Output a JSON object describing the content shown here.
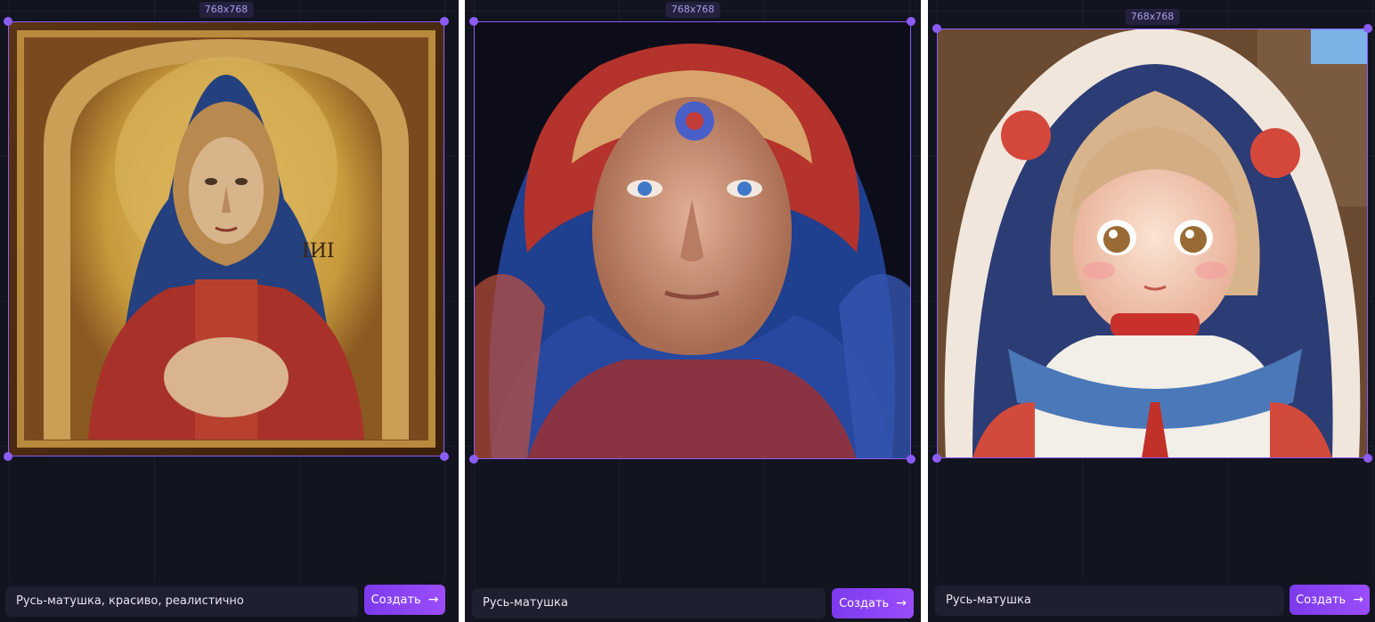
{
  "panels": [
    {
      "size_label": "768x768",
      "prompt": "Русь-матушка, красиво, реалистично",
      "button_label": "Создать",
      "button_icon": "arrow-right-icon",
      "image_subject": "icon-style portrait"
    },
    {
      "size_label": "768x768",
      "prompt": "Русь-матушка",
      "button_label": "Создать",
      "button_icon": "arrow-right-icon",
      "image_subject": "realistic portrait"
    },
    {
      "size_label": "768x768",
      "prompt": "Русь-матушка",
      "button_label": "Создать",
      "button_icon": "arrow-right-icon",
      "image_subject": "anime portrait"
    }
  ],
  "colors": {
    "panel_bg": "#12141f",
    "accent": "#8b5cf6",
    "input_bg": "#1e2030",
    "button": "#7c3aed"
  }
}
